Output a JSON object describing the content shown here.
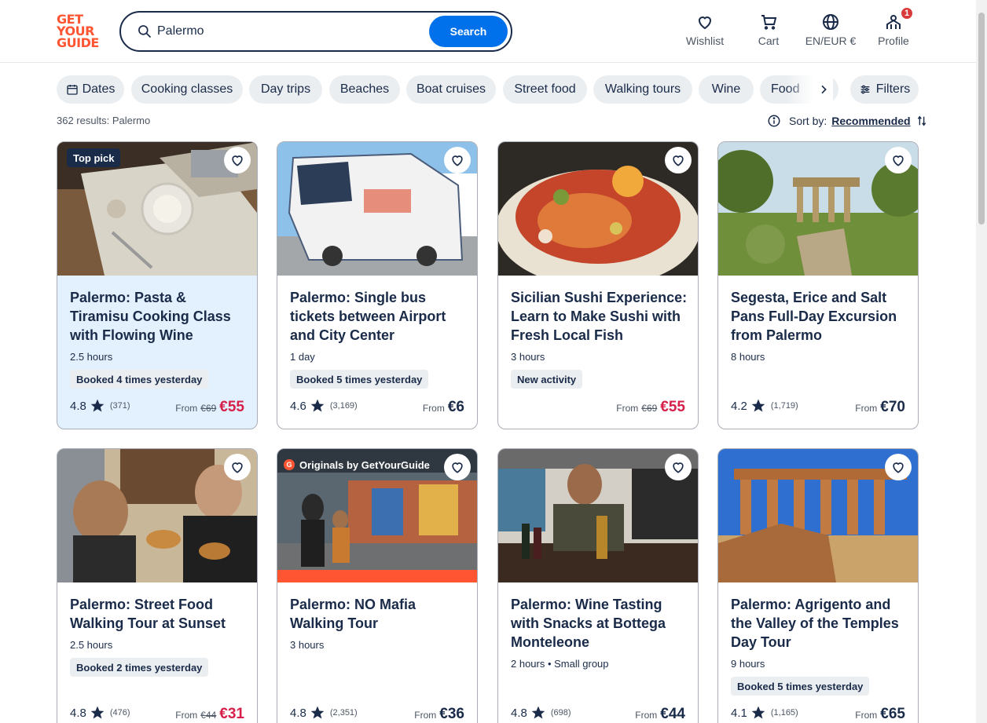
{
  "header": {
    "logo_lines": [
      "GET",
      "YOUR",
      "GUIDE"
    ],
    "search_value": "Palermo",
    "search_button": "Search",
    "nav": {
      "wishlist": "Wishlist",
      "cart": "Cart",
      "language": "EN/EUR €",
      "profile": "Profile",
      "profile_badge": "1"
    }
  },
  "chips": [
    "Dates",
    "Cooking classes",
    "Day trips",
    "Beaches",
    "Boat cruises",
    "Street food",
    "Walking tours",
    "Wine",
    "Food"
  ],
  "filters_label": "Filters",
  "results_text": "362 results: Palermo",
  "sort": {
    "label": "Sort by:",
    "value": "Recommended"
  },
  "cards": [
    {
      "title": "Palermo: Pasta & Tiramisu Cooking Class with Flowing Wine",
      "duration": "2.5 hours",
      "badge": "Booked 4 times yesterday",
      "rating": "4.8",
      "reviews": "(371)",
      "from": "From",
      "old_price": "€69",
      "price": "€55",
      "tag": "Top pick"
    },
    {
      "title": "Palermo: Single bus tickets between Airport and City Center",
      "duration": "1 day",
      "badge": "Booked 5 times yesterday",
      "rating": "4.6",
      "reviews": "(3,169)",
      "from": "From",
      "price": "€6"
    },
    {
      "title": "Sicilian Sushi Experience: Learn to Make Sushi with Fresh Local Fish",
      "duration": "3 hours",
      "badge": "New activity",
      "from": "From",
      "old_price": "€69",
      "price": "€55"
    },
    {
      "title": "Segesta, Erice and Salt Pans Full-Day Excursion from Palermo",
      "duration": "8 hours",
      "rating": "4.2",
      "reviews": "(1,719)",
      "from": "From",
      "price": "€70"
    },
    {
      "title": "Palermo: Street Food Walking Tour at Sunset",
      "duration": "2.5 hours",
      "badge": "Booked 2 times yesterday",
      "rating": "4.8",
      "reviews": "(476)",
      "from": "From",
      "old_price": "€44",
      "price": "€31"
    },
    {
      "title": "Palermo: NO Mafia Walking Tour",
      "duration": "3 hours",
      "rating": "4.8",
      "reviews": "(2,351)",
      "from": "From",
      "price": "€36",
      "tag": "Originals by GetYourGuide"
    },
    {
      "title": "Palermo: Wine Tasting with Snacks at Bottega Monteleone",
      "duration": "2 hours • Small group",
      "rating": "4.8",
      "reviews": "(698)",
      "from": "From",
      "price": "€44"
    },
    {
      "title": "Palermo: Agrigento and the Valley of the Temples Day Tour",
      "duration": "9 hours",
      "badge": "Booked 5 times yesterday",
      "rating": "4.1",
      "reviews": "(1,165)",
      "from": "From",
      "price": "€65"
    }
  ],
  "colors": {
    "brand": "#ff5533",
    "primary": "#0071eb",
    "text": "#1a2b49",
    "sale": "#d6204a",
    "chip_bg": "#ebeef1",
    "highlight_bg": "#e3f0fd"
  }
}
